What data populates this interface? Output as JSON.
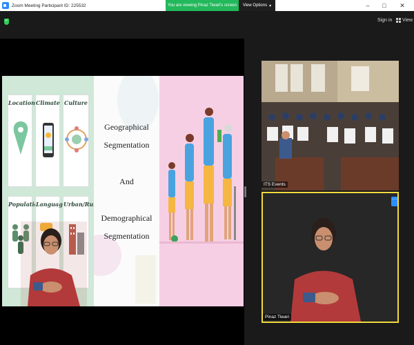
{
  "titlebar": {
    "title": "Zoom Meeting Participant ID: 225532",
    "minimize": "–",
    "maximize": "□",
    "close": "✕"
  },
  "share": {
    "banner_text": "You are viewing Pinaz Tiwari's screen",
    "view_options": "View Options",
    "view_options_caret": "▾"
  },
  "toolbar": {
    "sign_in": "Sign in",
    "view": "View"
  },
  "slide": {
    "cards": [
      "Location",
      "Climate",
      "Culture",
      "Population",
      "Language",
      "Urban/Rural"
    ],
    "title_lines": [
      "Geographical",
      "Segmentation",
      "And",
      "Demographical",
      "Segmentation"
    ]
  },
  "videos": {
    "room_name": "ITS Events",
    "speaker_name": "Pinaz Tiwari",
    "more_label": "···"
  },
  "colors": {
    "share_banner": "#23b85b",
    "active_speaker_border": "#f2dc3c",
    "zoom_blue": "#2d8cff"
  }
}
